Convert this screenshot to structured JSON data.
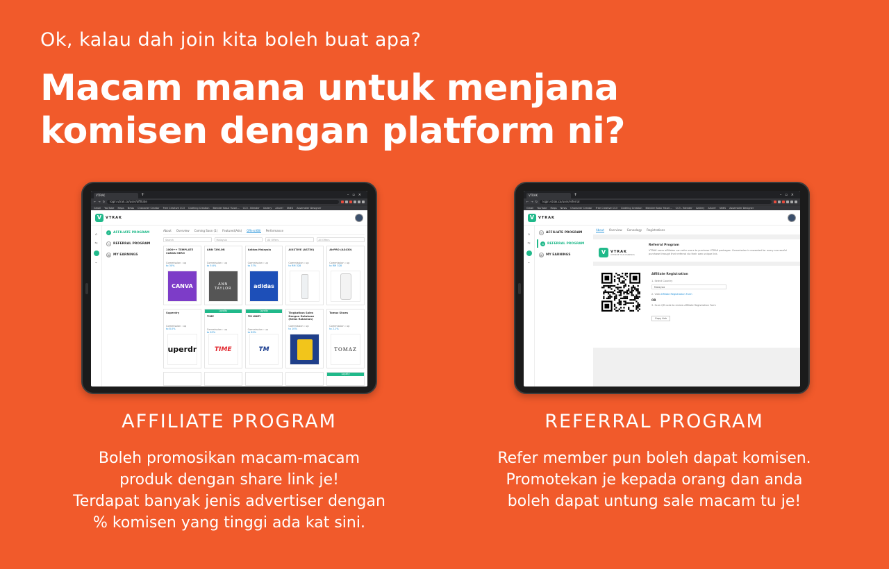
{
  "kicker": "Ok, kalau dah join kita boleh buat apa?",
  "headline": [
    "Macam mana untuk menjana",
    "komisen dengan platform ni?"
  ],
  "browser": {
    "tab_title": "VTRAK",
    "url_left": "login.vtrak.co/user/affiliate",
    "url_right": "login.vtrak.co/user/referral",
    "bookmarks": [
      "Gmail",
      "YouTube",
      "Maps",
      "News",
      "Character Creator",
      "Free Creative CC3",
      "Clothing Creation",
      "Blender Basic Tutori...",
      "CC3 - Blender",
      "Gallery",
      "Allure!",
      "SNES",
      "Assembler Designer"
    ]
  },
  "app": {
    "brand": "VTRAK",
    "nav": {
      "affiliate": "AFFILIATE PROGRAM",
      "referral": "REFERRAL PROGRAM",
      "earnings": "MY EARNINGS"
    }
  },
  "affiliate_screen": {
    "tabs": [
      "About",
      "Overview",
      "Coming Soon (1)",
      "Featured(Ads)",
      "Offers(68)",
      "Performance"
    ],
    "filters": [
      "Search",
      "Malaysia",
      "All Offers",
      "All Offers"
    ],
    "commission_label": "Commission : up",
    "tag_label": "Loyalty",
    "row1": [
      {
        "name": "1000++ TEMPLATE CANVA HERO",
        "rate": "to 30%",
        "thumb": "CANVA"
      },
      {
        "name": "ANN TAYLOR",
        "rate": "to 5.6%",
        "thumb": "ANN TAYLOR"
      },
      {
        "name": "Adidas Malaysia",
        "rate": "to 37%",
        "thumb": "adidas"
      },
      {
        "name": "AIXSTIVE (AST50)",
        "rate": "to RM 328",
        "thumb": ""
      },
      {
        "name": "AirPRO (AS430)",
        "rate": "to RM 328",
        "thumb": ""
      }
    ],
    "row2": [
      {
        "name": "Superdry",
        "rate": "to 8.0%",
        "thumb": "uperdr",
        "tag": ""
      },
      {
        "name": "TIME",
        "rate": "to 63%",
        "thumb": "TIME",
        "tag": "Loyalty"
      },
      {
        "name": "TM UNIFI",
        "rate": "to 85%",
        "thumb": "TM",
        "tag": "Loyalty"
      },
      {
        "name": "Tingkatkan Sales Dengan Database (Kelas Rakaman)",
        "rate": "to 10%",
        "thumb": "",
        "tag": ""
      },
      {
        "name": "Tomaz Shoes",
        "rate": "to 2.1%",
        "thumb": "TOMAZ",
        "tag": ""
      }
    ]
  },
  "referral_screen": {
    "tabs": [
      "About",
      "Overview",
      "Genealogy",
      "Registrations"
    ],
    "brand_sub": "OPTIMIZE YOUR EARNINGS",
    "program_title": "Referral Program",
    "program_text": "VTRAK users affiliates can refer users to purchase VTRAK packages. Commission is rewarded for every successful purchase through their referral via their own unique link.",
    "registration_title": "Affiliate Registration",
    "step1": "1. Select Country",
    "country": "Malaysia",
    "step2_prefix": "2. Visit",
    "step2_link": "Affiliate Registration Form",
    "or": "OR",
    "step3": "3. Scan QR code to review Affiliate Registration Form",
    "copy_button": "Copy Link"
  },
  "captions": {
    "left_title": "AFFILIATE PROGRAM",
    "left_body": [
      "Boleh promosikan macam-macam",
      "produk dengan share link je!",
      "Terdapat banyak jenis advertiser dengan",
      "% komisen yang tinggi ada kat sini."
    ],
    "right_title": "REFERRAL PROGRAM",
    "right_body": [
      "Refer member pun boleh dapat komisen.",
      "Promotekan je kepada orang dan anda",
      "boleh dapat untung sale macam tu je!"
    ]
  },
  "colors": {
    "background": "#F15A2B",
    "accent": "#20B98A",
    "link": "#1F8FD8"
  }
}
